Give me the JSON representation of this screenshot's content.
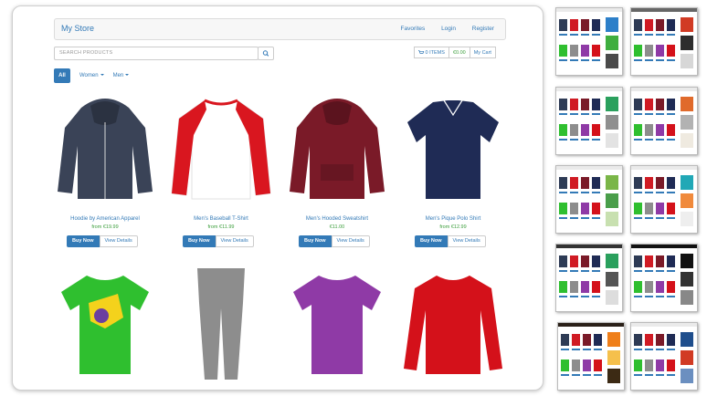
{
  "store": {
    "brand": "My Store",
    "nav": [
      "Favorites",
      "Login",
      "Register"
    ]
  },
  "search": {
    "placeholder": "SEARCH PRODUCTS"
  },
  "cart": {
    "items": "0 ITEMS",
    "total": "€0.00",
    "label": "My Cart"
  },
  "filters": {
    "all": "All",
    "women": "Women",
    "men": "Men"
  },
  "products": [
    {
      "name": "Hoodie by American Apparel",
      "price": "from €19.99",
      "color": "#3a4357",
      "shape": "hoodie-zip"
    },
    {
      "name": "Men's Baseball T-Shirt",
      "price": "from €11.99",
      "color": "#d9161f",
      "shape": "raglan"
    },
    {
      "name": "Men's Hooded Sweatshirt",
      "price": "€11.00",
      "color": "#7a1a28",
      "shape": "hoodie"
    },
    {
      "name": "Men's Pique Polo Shirt",
      "price": "from €12.99",
      "color": "#1f2b55",
      "shape": "polo"
    },
    {
      "name": "",
      "price": "",
      "color": "#2fbf2f",
      "shape": "tee-print"
    },
    {
      "name": "",
      "price": "",
      "color": "#8d8d8d",
      "shape": "pants"
    },
    {
      "name": "",
      "price": "",
      "color": "#8f3aa6",
      "shape": "tee"
    },
    {
      "name": "",
      "price": "",
      "color": "#d4111a",
      "shape": "longsleeve"
    }
  ],
  "buttons": {
    "buy": "Buy Now",
    "details": "View Details"
  },
  "themes": [
    {
      "header": "#eaeaea",
      "swatches": [
        "#2d7fc9",
        "#3fae3f",
        "#4a4a4a"
      ]
    },
    {
      "header": "#666666",
      "swatches": [
        "#d13b24",
        "#2d2d2d",
        "#d7d7d7"
      ]
    },
    {
      "header": "#eaeaea",
      "swatches": [
        "#2aa05d",
        "#8f8f8f",
        "#e3e3e3"
      ]
    },
    {
      "header": "#eaeaea",
      "swatches": [
        "#e06a2b",
        "#b2b2b2",
        "#efeae0"
      ]
    },
    {
      "header": "#eaeaea",
      "swatches": [
        "#7ab648",
        "#4a9e4a",
        "#c8e0b0"
      ]
    },
    {
      "header": "#eaeaea",
      "swatches": [
        "#21a8b6",
        "#f08a3c",
        "#eeeeee"
      ]
    },
    {
      "header": "#333333",
      "swatches": [
        "#2aa05d",
        "#555555",
        "#dddddd"
      ]
    },
    {
      "header": "#111111",
      "swatches": [
        "#111111",
        "#333333",
        "#888888"
      ]
    },
    {
      "header": "#2a2018",
      "swatches": [
        "#ef7f1a",
        "#f5c04c",
        "#3c2a14"
      ]
    },
    {
      "header": "#eaeaea",
      "swatches": [
        "#1f4e8c",
        "#d13b24",
        "#6b8fc0"
      ]
    }
  ]
}
